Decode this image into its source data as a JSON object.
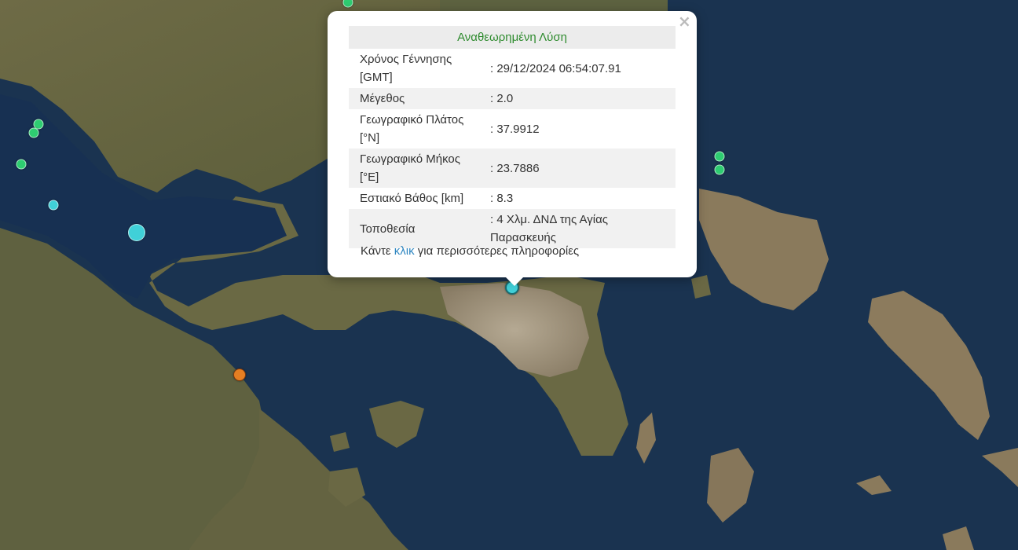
{
  "map": {
    "type": "satellite",
    "colors": {
      "sea": "#1a3350",
      "land": "#6b6a45",
      "urban": "#a89c86"
    },
    "markers": [
      {
        "color": "#2ecc71",
        "size": "small"
      },
      {
        "color": "#2ecc71",
        "size": "small"
      },
      {
        "color": "#2ecc71",
        "size": "small"
      },
      {
        "color": "#2ecc71",
        "size": "small"
      },
      {
        "color": "#40d0d8",
        "size": "small"
      },
      {
        "color": "#40d0d8",
        "size": "large"
      },
      {
        "color": "#2ecc71",
        "size": "small"
      },
      {
        "color": "#2ecc71",
        "size": "small"
      },
      {
        "color": "#e67e22",
        "size": "medium"
      },
      {
        "color": "#40d0d8",
        "size": "selected"
      }
    ]
  },
  "popup": {
    "title": "Αναθεωρημένη Λύση",
    "title_color": "#2e8b2e",
    "close_icon": "close-icon",
    "rows": [
      {
        "label": "Χρόνος Γέννησης [GMT]",
        "value": ": 29/12/2024 06:54:07.91"
      },
      {
        "label": "Μέγεθος",
        "value": ": 2.0"
      },
      {
        "label": "Γεωγραφικό Πλάτος [°N]",
        "value": ": 37.9912"
      },
      {
        "label": "Γεωγραφικό Μήκος [°E]",
        "value": ": 23.7886"
      },
      {
        "label": "Εστιακό Βάθος [km]",
        "value": ": 8.3"
      },
      {
        "label": "Τοποθεσία",
        "value": ": 4 Χλμ. ΔΝΔ της Αγίας Παρασκευής"
      }
    ],
    "hint_before": "Κάντε ",
    "hint_link": "κλικ",
    "hint_after": " για περισσότερες πληροφορίες",
    "link_color": "#2e86c1"
  }
}
